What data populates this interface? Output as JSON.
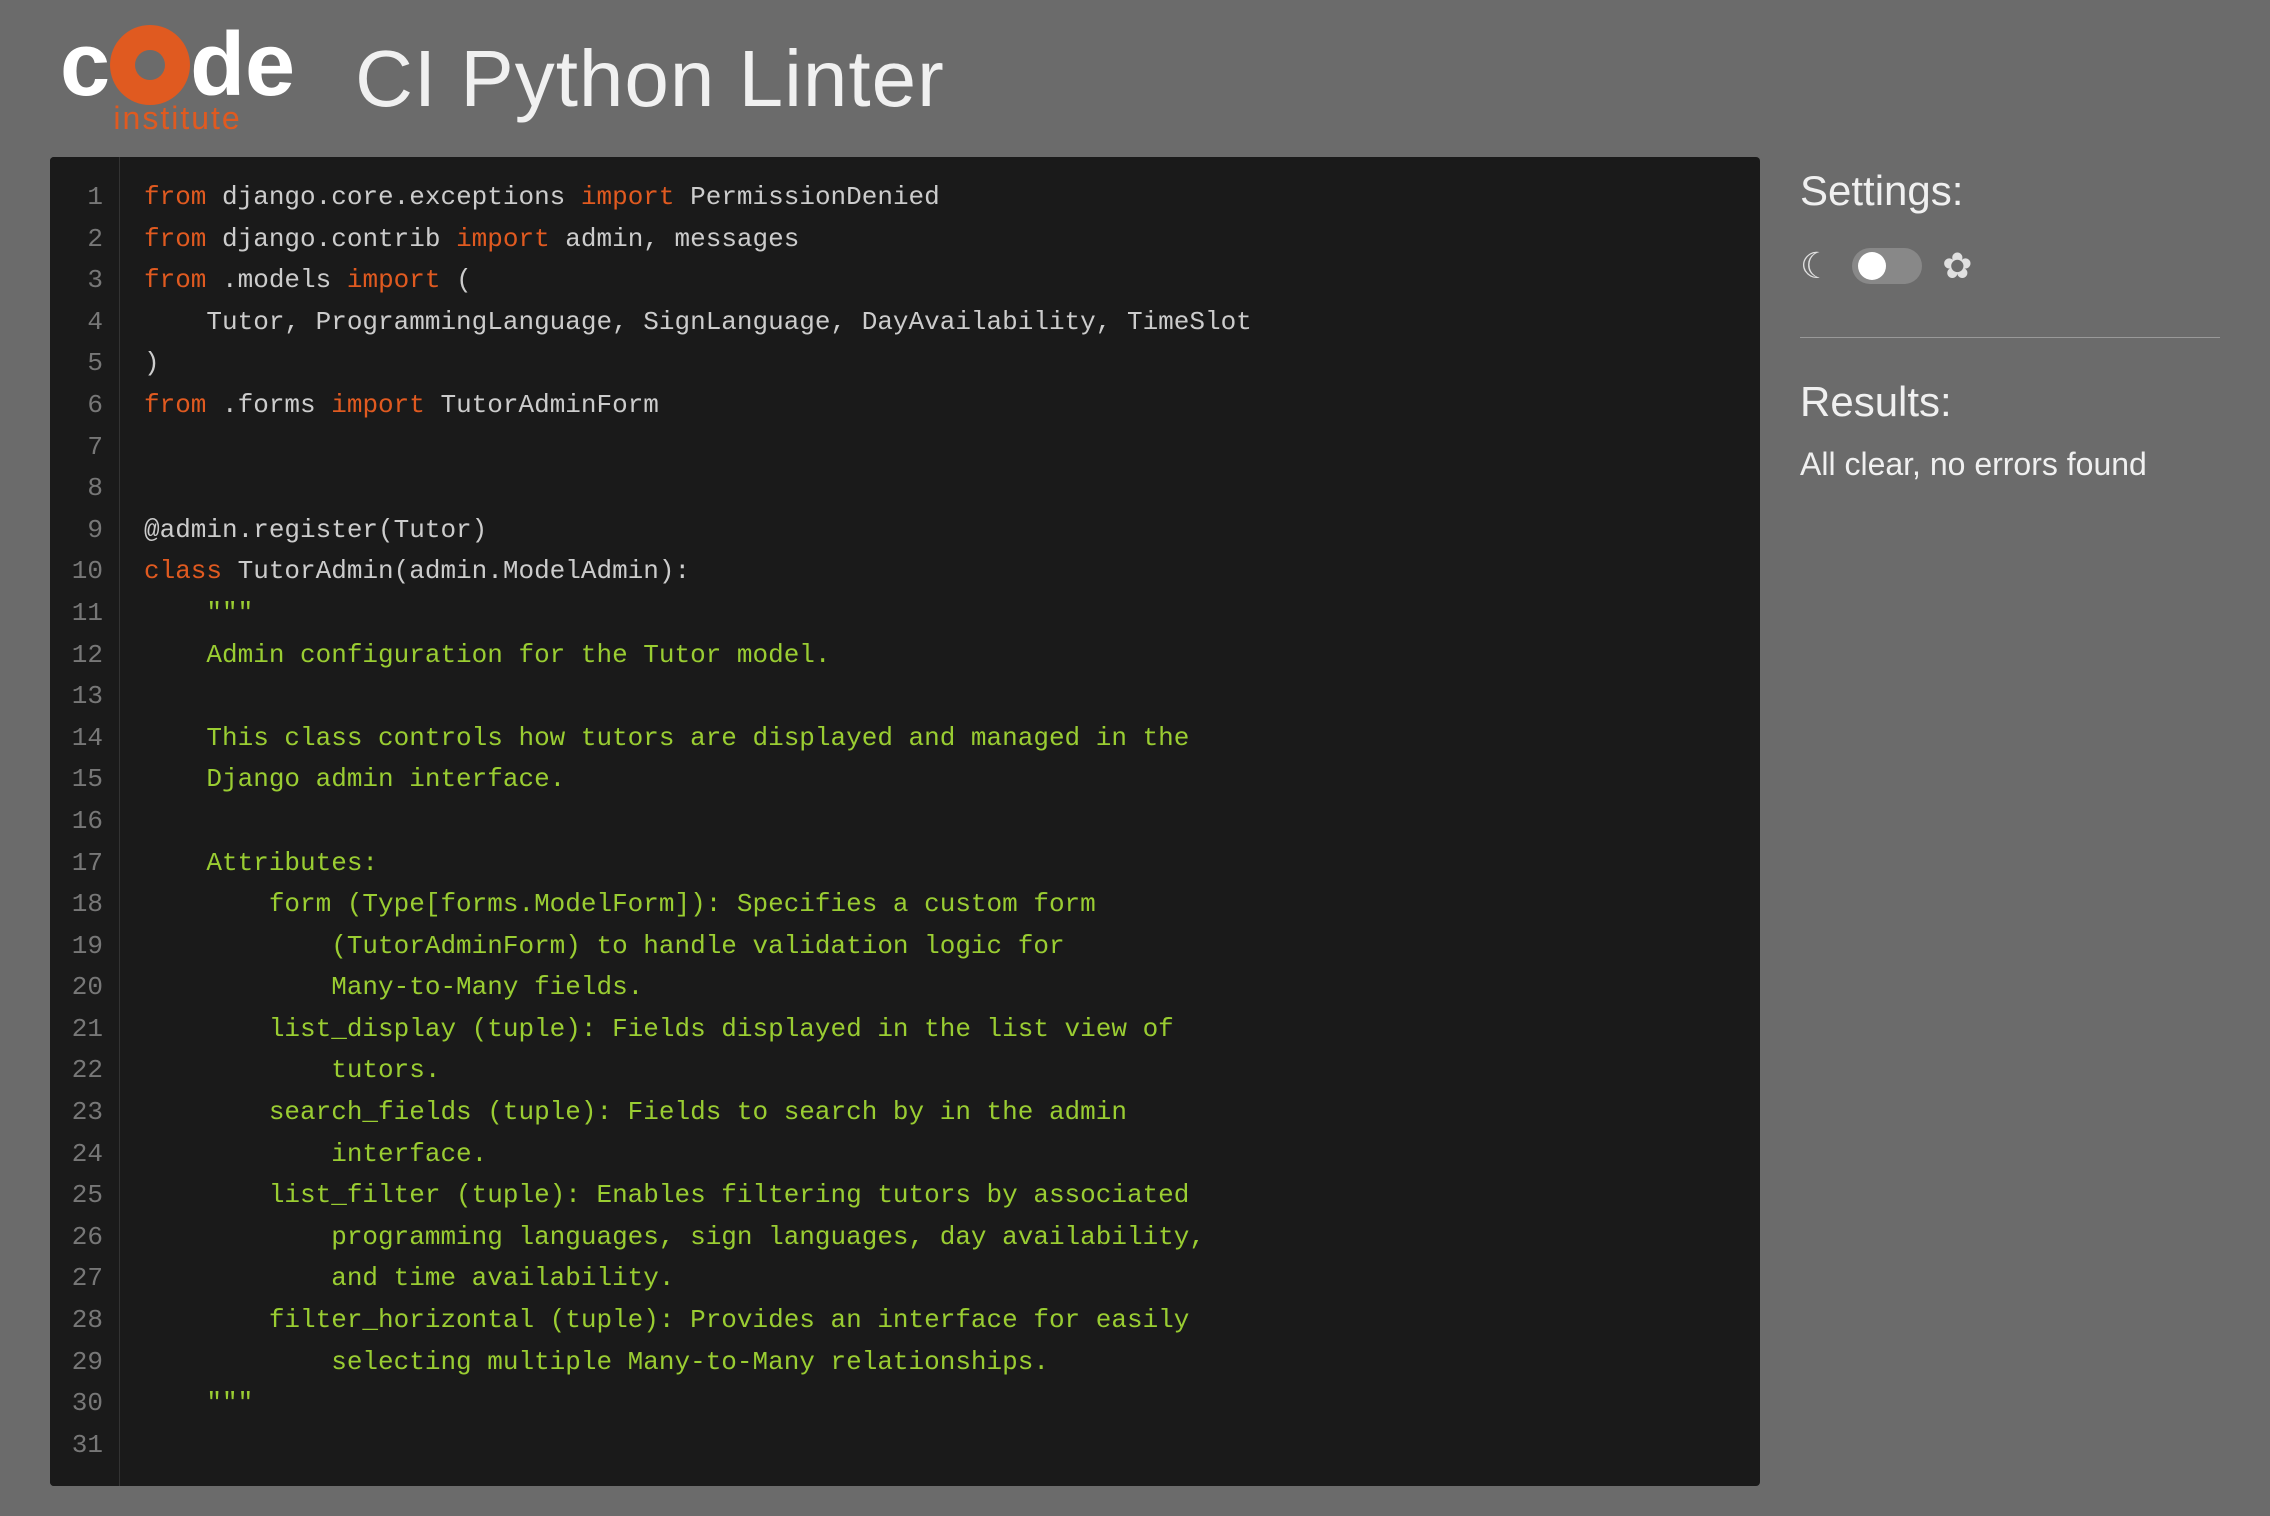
{
  "header": {
    "logo": {
      "letters": [
        "c",
        "o",
        "d",
        "e"
      ],
      "subtitle": "institute"
    },
    "title": "CI Python Linter"
  },
  "settings": {
    "label": "Settings:",
    "theme_toggle_state": "dark"
  },
  "results": {
    "label": "Results:",
    "message": "All clear, no errors found"
  },
  "code": {
    "lines": [
      {
        "num": 1,
        "content": "from django.core.exceptions import PermissionDenied"
      },
      {
        "num": 2,
        "content": "from django.contrib import admin, messages"
      },
      {
        "num": 3,
        "content": "from .models import ("
      },
      {
        "num": 4,
        "content": "    Tutor, ProgrammingLanguage, SignLanguage, DayAvailability, TimeSlot"
      },
      {
        "num": 5,
        "content": ")"
      },
      {
        "num": 6,
        "content": "from .forms import TutorAdminForm"
      },
      {
        "num": 7,
        "content": ""
      },
      {
        "num": 8,
        "content": ""
      },
      {
        "num": 9,
        "content": "@admin.register(Tutor)"
      },
      {
        "num": 10,
        "content": "class TutorAdmin(admin.ModelAdmin):"
      },
      {
        "num": 11,
        "content": "    \"\"\""
      },
      {
        "num": 12,
        "content": "    Admin configuration for the Tutor model."
      },
      {
        "num": 13,
        "content": ""
      },
      {
        "num": 14,
        "content": "    This class controls how tutors are displayed and managed in the"
      },
      {
        "num": 15,
        "content": "    Django admin interface."
      },
      {
        "num": 16,
        "content": ""
      },
      {
        "num": 17,
        "content": "    Attributes:"
      },
      {
        "num": 18,
        "content": "        form (Type[forms.ModelForm]): Specifies a custom form"
      },
      {
        "num": 19,
        "content": "            (TutorAdminForm) to handle validation logic for"
      },
      {
        "num": 20,
        "content": "            Many-to-Many fields."
      },
      {
        "num": 21,
        "content": "        list_display (tuple): Fields displayed in the list view of"
      },
      {
        "num": 22,
        "content": "            tutors."
      },
      {
        "num": 23,
        "content": "        search_fields (tuple): Fields to search by in the admin"
      },
      {
        "num": 24,
        "content": "            interface."
      },
      {
        "num": 25,
        "content": "        list_filter (tuple): Enables filtering tutors by associated"
      },
      {
        "num": 26,
        "content": "            programming languages, sign languages, day availability,"
      },
      {
        "num": 27,
        "content": "            and time availability."
      },
      {
        "num": 28,
        "content": "        filter_horizontal (tuple): Provides an interface for easily"
      },
      {
        "num": 29,
        "content": "            selecting multiple Many-to-Many relationships."
      },
      {
        "num": 30,
        "content": "    \"\"\""
      },
      {
        "num": 31,
        "content": ""
      }
    ]
  },
  "colors": {
    "bg": "#6b6b6b",
    "code_bg": "#1a1a1a",
    "orange": "#e05a20",
    "keyword": "#e05a20",
    "doc_comment": "#9acd32",
    "normal_text": "#cccccc",
    "line_num": "#777777"
  }
}
